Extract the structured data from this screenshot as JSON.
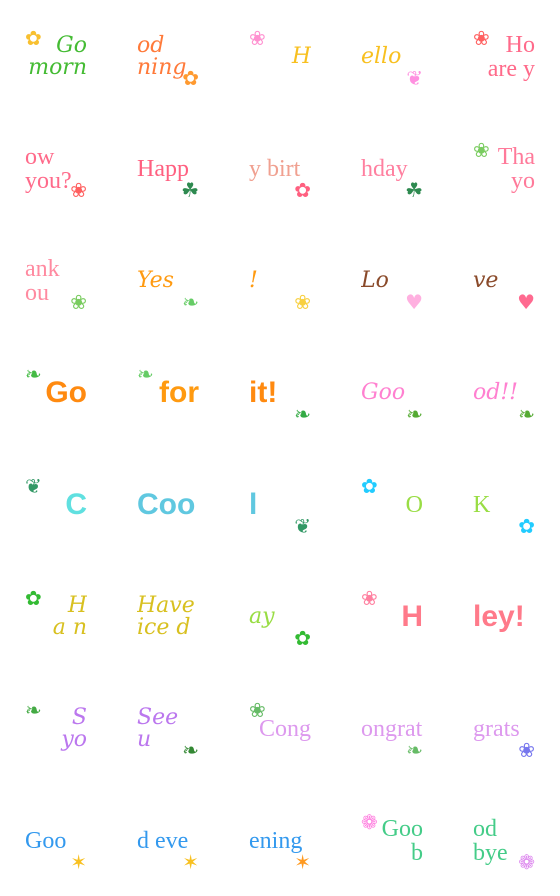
{
  "cells": [
    {
      "text": "Go\nmorn",
      "style": "script",
      "color": "#44bb33",
      "deco": "flower-icon",
      "glyph": "✿",
      "deco_color": "#f8c030",
      "align": "right"
    },
    {
      "text": "od\nning",
      "style": "script",
      "color": "#ff7a3a",
      "deco": "flower-icon",
      "glyph": "✿",
      "deco_color": "#ff9a30",
      "align": "left"
    },
    {
      "text": "H",
      "style": "script",
      "color": "#f8c020",
      "deco": "tulip-icon",
      "glyph": "❀",
      "deco_color": "#ff90d0",
      "align": "right"
    },
    {
      "text": "ello",
      "style": "script",
      "color": "#f8c020",
      "deco": "ribbon-icon",
      "glyph": "❦",
      "deco_color": "#ff90e0",
      "align": "left"
    },
    {
      "text": "Ho\nare y",
      "style": "serif",
      "color": "#ff6a8a",
      "deco": "tulip-icon",
      "glyph": "❀",
      "deco_color": "#ff6060",
      "align": "right"
    },
    {
      "text": "ow\nyou?",
      "style": "serif",
      "color": "#ff6a8a",
      "deco": "tulip-icon",
      "glyph": "❀",
      "deco_color": "#ff6060",
      "align": "left"
    },
    {
      "text": "Happ",
      "style": "serif",
      "color": "#ff6080",
      "deco": "vine-icon",
      "glyph": "☘",
      "deco_color": "#2e8a50",
      "align": "left"
    },
    {
      "text": "y birt",
      "style": "serif",
      "color": "#f0a090",
      "deco": "vine-icon",
      "glyph": "✿",
      "deco_color": "#ff6080",
      "align": "left"
    },
    {
      "text": "hday",
      "style": "serif",
      "color": "#ff80a0",
      "deco": "vine-icon",
      "glyph": "☘",
      "deco_color": "#2e8a50",
      "align": "left"
    },
    {
      "text": "Tha\nyo",
      "style": "serif",
      "color": "#ff7a9a",
      "deco": "flower-stem-icon",
      "glyph": "❀",
      "deco_color": "#7acc60",
      "align": "right"
    },
    {
      "text": "ank\nou",
      "style": "serif",
      "color": "#ff8aa0",
      "deco": "flower-stem-icon",
      "glyph": "❀",
      "deco_color": "#7acc60",
      "align": "left"
    },
    {
      "text": "Yes",
      "style": "script",
      "color": "#ff9a10",
      "deco": "leaf-icon",
      "glyph": "❧",
      "deco_color": "#66cc66",
      "align": "left"
    },
    {
      "text": "!",
      "style": "script",
      "color": "#ff9a10",
      "deco": "flower-branch-icon",
      "glyph": "❀",
      "deco_color": "#f8d040",
      "align": "left"
    },
    {
      "text": "Lo",
      "style": "script",
      "color": "#8a4a2a",
      "deco": "heart-icon",
      "glyph": "♥",
      "deco_color": "#ffb0e0",
      "align": "left"
    },
    {
      "text": "ve",
      "style": "script",
      "color": "#8a4a2a",
      "deco": "heart-icon",
      "glyph": "♥",
      "deco_color": "#ff6a90",
      "align": "left"
    },
    {
      "text": "Go",
      "style": "bold",
      "color": "#ff8a10",
      "deco": "leaf-icon",
      "glyph": "❧",
      "deco_color": "#44bb44",
      "align": "right"
    },
    {
      "text": "for",
      "style": "bold",
      "color": "#ff9a10",
      "deco": "leaf-icon",
      "glyph": "❧",
      "deco_color": "#66cc66",
      "align": "right"
    },
    {
      "text": "it!",
      "style": "bold",
      "color": "#ff8a10",
      "deco": "leaf-icon",
      "glyph": "❧",
      "deco_color": "#33aa44",
      "align": "left"
    },
    {
      "text": "Goo",
      "style": "script",
      "color": "#ff80d0",
      "deco": "leaf-icon",
      "glyph": "❧",
      "deco_color": "#55aa33",
      "align": "left"
    },
    {
      "text": "od!!",
      "style": "script",
      "color": "#ff80d0",
      "deco": "leaf-icon",
      "glyph": "❧",
      "deco_color": "#55aa33",
      "align": "left"
    },
    {
      "text": "C",
      "style": "bold",
      "color": "#60e0e0",
      "deco": "plant-icon",
      "glyph": "❦",
      "deco_color": "#339966",
      "align": "right"
    },
    {
      "text": "Coo",
      "style": "bold",
      "color": "#60c8e0",
      "deco": "",
      "glyph": "",
      "deco_color": "#339966",
      "align": "left"
    },
    {
      "text": "l",
      "style": "bold",
      "color": "#60c8e0",
      "deco": "plant-icon",
      "glyph": "❦",
      "deco_color": "#339966",
      "align": "left"
    },
    {
      "text": "O",
      "style": "serif",
      "color": "#99dd44",
      "deco": "flower-icon",
      "glyph": "✿",
      "deco_color": "#22ccff",
      "align": "right"
    },
    {
      "text": "K",
      "style": "serif",
      "color": "#99dd44",
      "deco": "flower-icon",
      "glyph": "✿",
      "deco_color": "#22ccff",
      "align": "left"
    },
    {
      "text": "H\na n",
      "style": "script",
      "color": "#d8c020",
      "deco": "flower-bush-icon",
      "glyph": "✿",
      "deco_color": "#33bb33",
      "align": "right"
    },
    {
      "text": "Have\nice d",
      "style": "script",
      "color": "#d8c020",
      "deco": "",
      "glyph": "",
      "deco_color": "#99dd44",
      "align": "left"
    },
    {
      "text": "ay",
      "style": "script",
      "color": "#99dd44",
      "deco": "flower-bush-icon",
      "glyph": "✿",
      "deco_color": "#33bb33",
      "align": "left"
    },
    {
      "text": "H",
      "style": "bold",
      "color": "#ff7a8a",
      "deco": "tulip-icon",
      "glyph": "❀",
      "deco_color": "#ff80a0",
      "align": "right"
    },
    {
      "text": "ley!",
      "style": "bold",
      "color": "#ff7a8a",
      "deco": "",
      "glyph": "",
      "deco_color": "#ff7a8a",
      "align": "left"
    },
    {
      "text": "S\nyo",
      "style": "script",
      "color": "#bb77ee",
      "deco": "leaf-icon",
      "glyph": "❧",
      "deco_color": "#44aa44",
      "align": "right"
    },
    {
      "text": "See\nu",
      "style": "script",
      "color": "#bb77ee",
      "deco": "leaf-icon",
      "glyph": "❧",
      "deco_color": "#338833",
      "align": "left"
    },
    {
      "text": "Cong",
      "style": "serif",
      "color": "#dd99ee",
      "deco": "wreath-icon",
      "glyph": "❀",
      "deco_color": "#66bb66",
      "align": "right"
    },
    {
      "text": "ongrat",
      "style": "serif",
      "color": "#dd99ee",
      "deco": "wreath-icon",
      "glyph": "❧",
      "deco_color": "#66bb66",
      "align": "left"
    },
    {
      "text": "grats",
      "style": "serif",
      "color": "#dd99ee",
      "deco": "wreath-icon",
      "glyph": "❀",
      "deco_color": "#7777ee",
      "align": "left"
    },
    {
      "text": "Goo",
      "style": "serif",
      "color": "#3399ee",
      "deco": "star-flower-icon",
      "glyph": "✶",
      "deco_color": "#f8c020",
      "align": "left"
    },
    {
      "text": "d eve",
      "style": "serif",
      "color": "#3399ee",
      "deco": "star-flower-icon",
      "glyph": "✶",
      "deco_color": "#f8c020",
      "align": "left"
    },
    {
      "text": "ening",
      "style": "serif",
      "color": "#3399ee",
      "deco": "star-flower-icon",
      "glyph": "✶",
      "deco_color": "#ff9a20",
      "align": "left"
    },
    {
      "text": "Goo\nb",
      "style": "serif",
      "color": "#44cc88",
      "deco": "rose-icon",
      "glyph": "❁",
      "deco_color": "#ff80e0",
      "align": "right"
    },
    {
      "text": "od\nbye",
      "style": "serif",
      "color": "#44cc88",
      "deco": "rose-icon",
      "glyph": "❁",
      "deco_color": "#dd88ee",
      "align": "left"
    }
  ]
}
